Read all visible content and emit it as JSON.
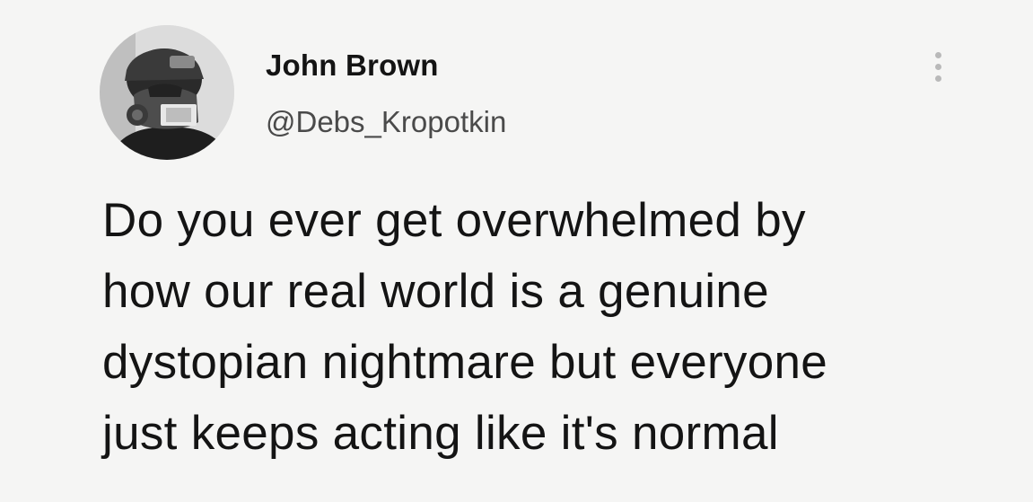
{
  "author": {
    "display_name": "John Brown",
    "handle": "@Debs_Kropotkin",
    "avatar_icon": "profile-photo-gas-mask"
  },
  "more_icon": "more-options-vertical-dots-icon",
  "tweet": {
    "lines": [
      "Do you ever get overwhelmed by",
      "how our real world is a genuine",
      "dystopian nightmare but everyone",
      "just keeps acting like it's normal"
    ]
  },
  "colors": {
    "background": "#f5f5f4",
    "text": "#141414",
    "handle": "#4a4a4a"
  }
}
